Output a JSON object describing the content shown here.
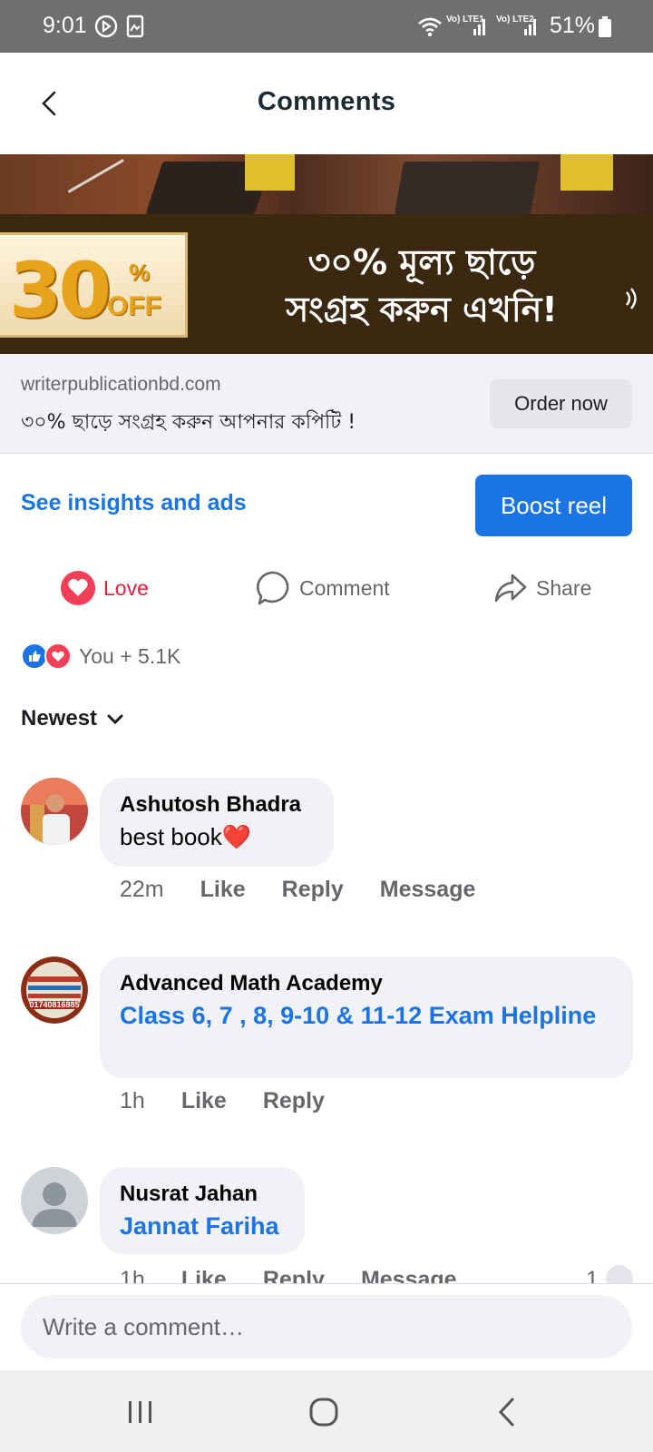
{
  "status_bar": {
    "time": "9:01",
    "battery": "51%",
    "sim1_label": "Vo) LTE1",
    "sim2_label": "Vo) LTE2"
  },
  "header": {
    "title": "Comments"
  },
  "banner": {
    "badge_number": "30",
    "badge_percent": "%",
    "badge_off": "OFF",
    "line1": "৩০% মূল্য ছাড়ে",
    "line2": "সংগ্রহ করুন এখনি!"
  },
  "ad": {
    "domain": "writerpublicationbd.com",
    "description": "৩০% ছাড়ে সংগ্রহ করুন আপনার কপিটি !",
    "cta_label": "Order now"
  },
  "insights": {
    "link_label": "See insights and ads",
    "boost_label": "Boost reel"
  },
  "actions": {
    "love": "Love",
    "comment": "Comment",
    "share": "Share"
  },
  "reactions": {
    "summary": "You + 5.1K"
  },
  "sort": {
    "label": "Newest"
  },
  "comments": [
    {
      "name": "Ashutosh Bhadra",
      "text": "best book❤️",
      "time": "22m",
      "like": "Like",
      "reply": "Reply",
      "message": "Message"
    },
    {
      "name": "Advanced Math Academy",
      "text": "Class  6,  7 ,  8,  9-10  &  11-12  Exam Helpline",
      "time": "1h",
      "like": "Like",
      "reply": "Reply",
      "avatar_text": "01740816885"
    },
    {
      "name": "Nusrat Jahan",
      "text": "Jannat Fariha",
      "time": "1h",
      "like": "Like",
      "reply": "Reply",
      "message": "Message",
      "reaction_count": "1"
    }
  ],
  "composer": {
    "placeholder": "Write a comment…"
  },
  "colors": {
    "accent": "#1b74e4",
    "love": "#e41e3f",
    "bubble": "#f0f2f5",
    "status_bar": "#6f6f6f"
  }
}
